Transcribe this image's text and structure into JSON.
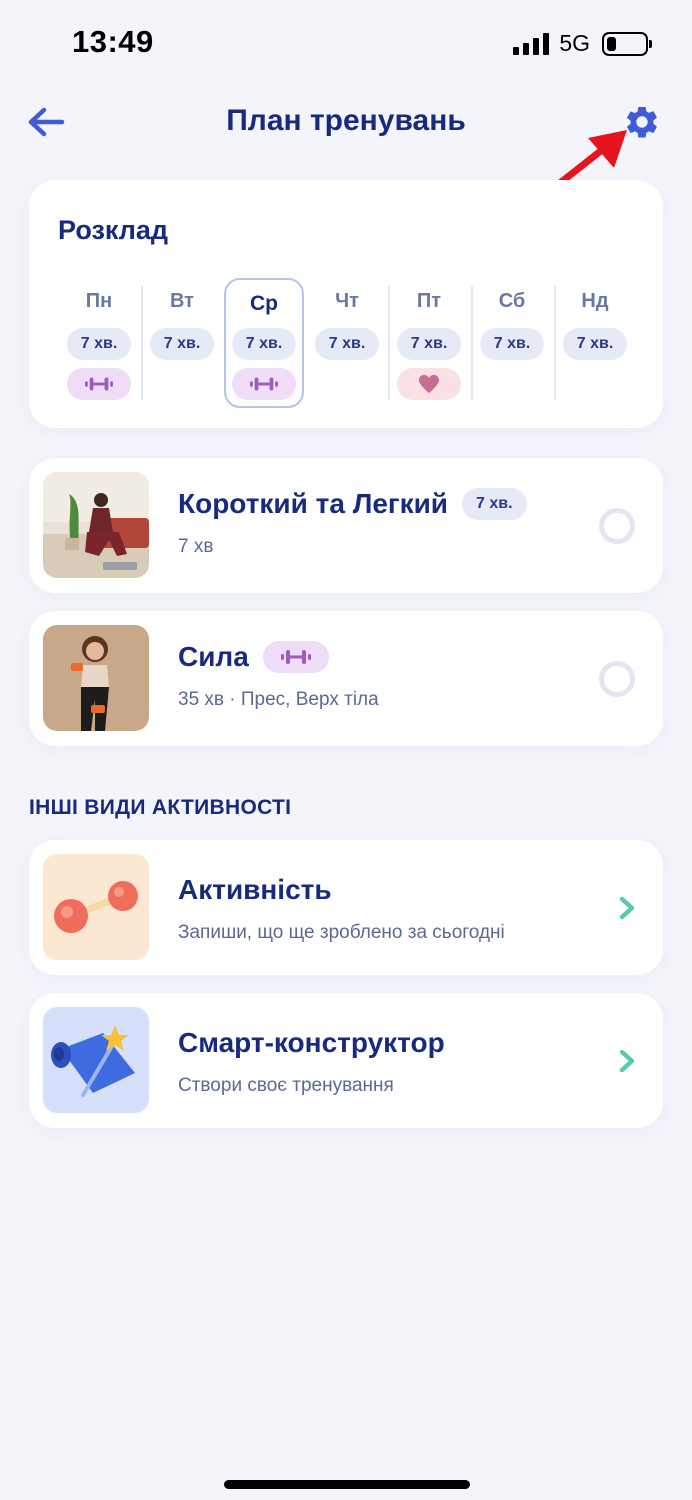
{
  "status_bar": {
    "time": "13:49",
    "network": "5G",
    "battery_level": 0.25
  },
  "header": {
    "title": "План тренувань",
    "back_icon": "arrow-left-icon",
    "settings_icon": "gear-icon"
  },
  "schedule": {
    "title": "Розклад",
    "days": [
      {
        "name": "Пн",
        "minutes": "7 хв.",
        "activity": "strength"
      },
      {
        "name": "Вт",
        "minutes": "7 хв.",
        "activity": null
      },
      {
        "name": "Ср",
        "minutes": "7 хв.",
        "activity": "strength",
        "selected": true
      },
      {
        "name": "Чт",
        "minutes": "7 хв.",
        "activity": null
      },
      {
        "name": "Пт",
        "minutes": "7 хв.",
        "activity": "heart"
      },
      {
        "name": "Сб",
        "minutes": "7 хв.",
        "activity": null
      },
      {
        "name": "Нд",
        "minutes": "7 хв.",
        "activity": null
      }
    ]
  },
  "workouts": [
    {
      "title": "Короткий та Легкий",
      "badge": "7 хв.",
      "subtitle": "7 хв",
      "completed": false
    },
    {
      "title": "Сила",
      "badge_icon": "dumbbell-icon",
      "subtitle": "35 хв · Прес, Верх тіла",
      "completed": false
    }
  ],
  "other_section": {
    "heading": "ІНШІ ВИДИ АКТИВНОСТІ",
    "items": [
      {
        "title": "Активність",
        "subtitle": "Запиши, що ще зроблено за сьогодні",
        "icon": "dumbbell-illustration"
      },
      {
        "title": "Смарт-конструктор",
        "subtitle": "Створи своє тренування",
        "icon": "yoga-mat-wand-illustration"
      }
    ]
  },
  "colors": {
    "background": "#f4f5fb",
    "title": "#182a7e",
    "accent_blue": "#3f5bd6",
    "chevron_teal": "#5ac8b4",
    "annotation_red": "#e8141c",
    "strength_pill": "#efdcf6",
    "heart_pill": "#fbe0e6"
  }
}
